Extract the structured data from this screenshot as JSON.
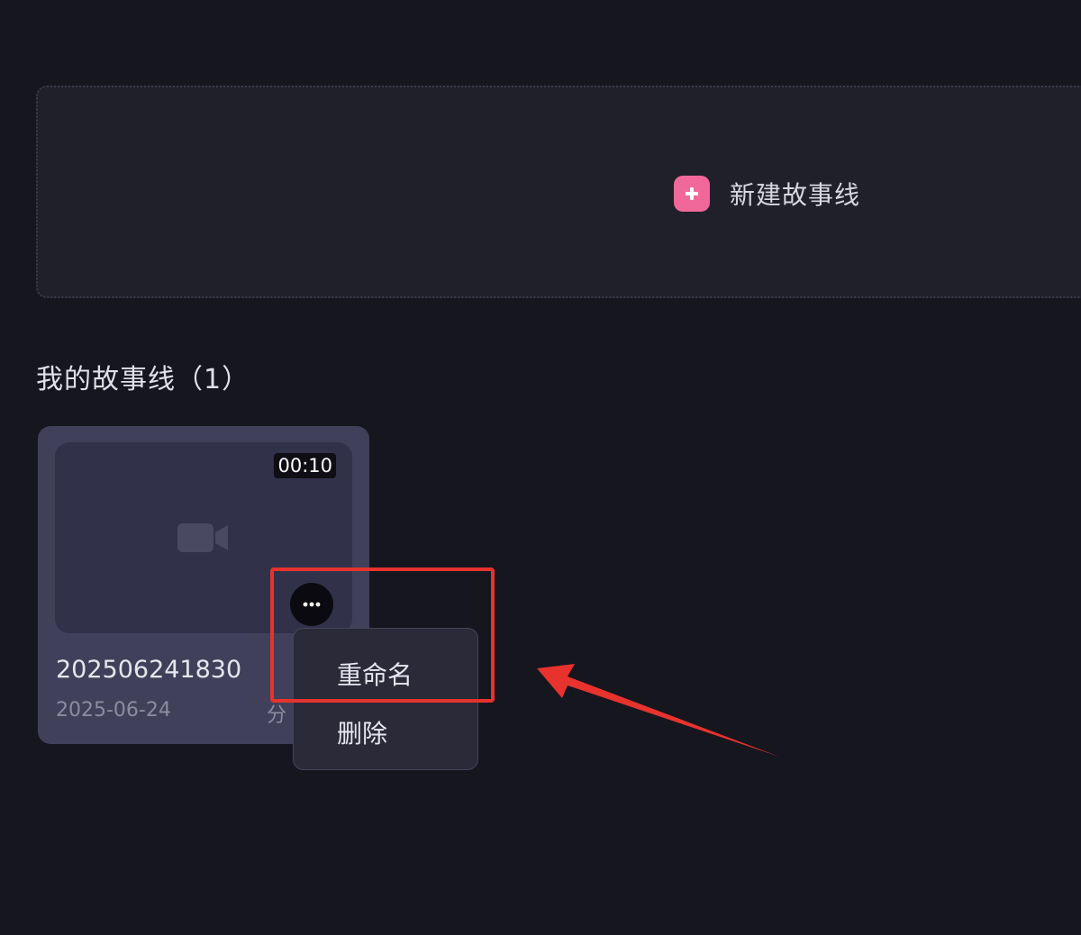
{
  "create": {
    "label": "新建故事线",
    "accent_color": "#f0689a"
  },
  "section": {
    "title": "我的故事线（1）"
  },
  "card": {
    "duration": "00:10",
    "name": "202506241830",
    "date": "2025-06-24",
    "extra": "分",
    "thumbnail_icon": "video-camera-icon"
  },
  "more_button": {
    "icon": "more-dots-icon",
    "label": "···"
  },
  "context_menu": {
    "items": [
      {
        "label": "重命名"
      },
      {
        "label": "删除"
      }
    ]
  },
  "annotation": {
    "highlight_color": "#e8322d"
  }
}
